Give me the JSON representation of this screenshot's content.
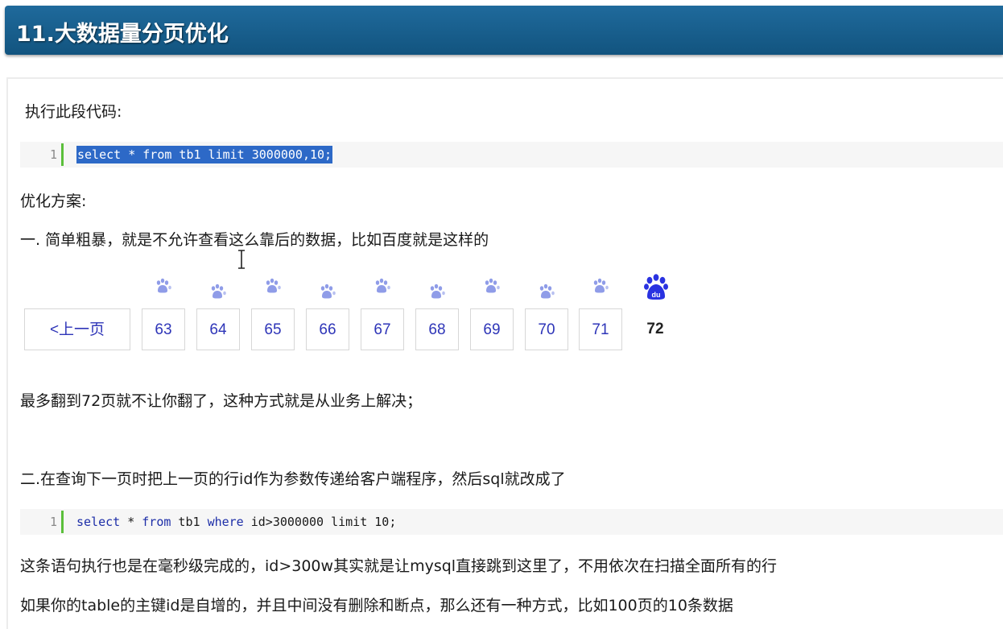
{
  "header": {
    "title": "11.大数据量分页优化"
  },
  "intro": {
    "label": "执行此段代码:"
  },
  "code1": {
    "line_number": "1",
    "code": "select * from tb1 limit 3000000,10;"
  },
  "plan_label": "优化方案:",
  "option1": {
    "text": "一. 简单粗暴，就是不允许查看这么靠后的数据，比如百度就是这样的"
  },
  "pager": {
    "prev_label": "<上一页",
    "pages": [
      "63",
      "64",
      "65",
      "66",
      "67",
      "68",
      "69",
      "70",
      "71"
    ],
    "current": "72",
    "logo_text": "du"
  },
  "note1": "最多翻到72页就不让你翻了，这种方式就是从业务上解决；",
  "option2": {
    "text": "二.在查询下一页时把上一页的行id作为参数传递给客户端程序，然后sql就改成了"
  },
  "code2": {
    "line_number": "1",
    "parts": [
      "select",
      " * ",
      "from",
      " tb1 ",
      "where",
      " id>3000000 limit 10;"
    ]
  },
  "para1": "这条语句执行也是在毫秒级完成的，id>300w其实就是让mysql直接跳到这里了，不用依次在扫描全面所有的行",
  "para2": "如果你的table的主键id是自增的，并且中间没有删除和断点，那么还有一种方式，比如100页的10条数据",
  "colors": {
    "header": "#18608f",
    "link": "#2e35b8",
    "selection": "#2d69c7",
    "gutter_bar": "#5bbf3b"
  }
}
